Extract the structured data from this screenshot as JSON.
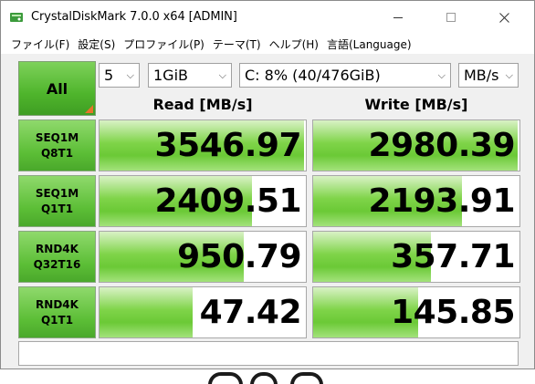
{
  "window": {
    "title": "CrystalDiskMark 7.0.0 x64 [ADMIN]"
  },
  "menu": [
    "ファイル(F)",
    "設定(S)",
    "プロファイル(P)",
    "テーマ(T)",
    "ヘルプ(H)",
    "言語(Language)"
  ],
  "controls": {
    "all_label": "All",
    "count": "5",
    "size": "1GiB",
    "drive": "C: 8% (40/476GiB)",
    "unit": "MB/s"
  },
  "headers": {
    "read": "Read [MB/s]",
    "write": "Write [MB/s]"
  },
  "tests": [
    {
      "line1": "SEQ1M",
      "line2": "Q8T1",
      "read": "3546.97",
      "write": "2980.39",
      "read_fill": 0.99,
      "write_fill": 0.99
    },
    {
      "line1": "SEQ1M",
      "line2": "Q1T1",
      "read": "2409.51",
      "write": "2193.91",
      "read_fill": 0.74,
      "write_fill": 0.72
    },
    {
      "line1": "RND4K",
      "line2": "Q32T16",
      "read": "950.79",
      "write": "357.71",
      "read_fill": 0.7,
      "write_fill": 0.57
    },
    {
      "line1": "RND4K",
      "line2": "Q1T1",
      "read": "47.42",
      "write": "145.85",
      "read_fill": 0.45,
      "write_fill": 0.51
    }
  ],
  "comment": "",
  "colors": {
    "accent_green": "#5cbe36",
    "bar_green": "#7fd449",
    "corner_orange": "#e8732a"
  }
}
